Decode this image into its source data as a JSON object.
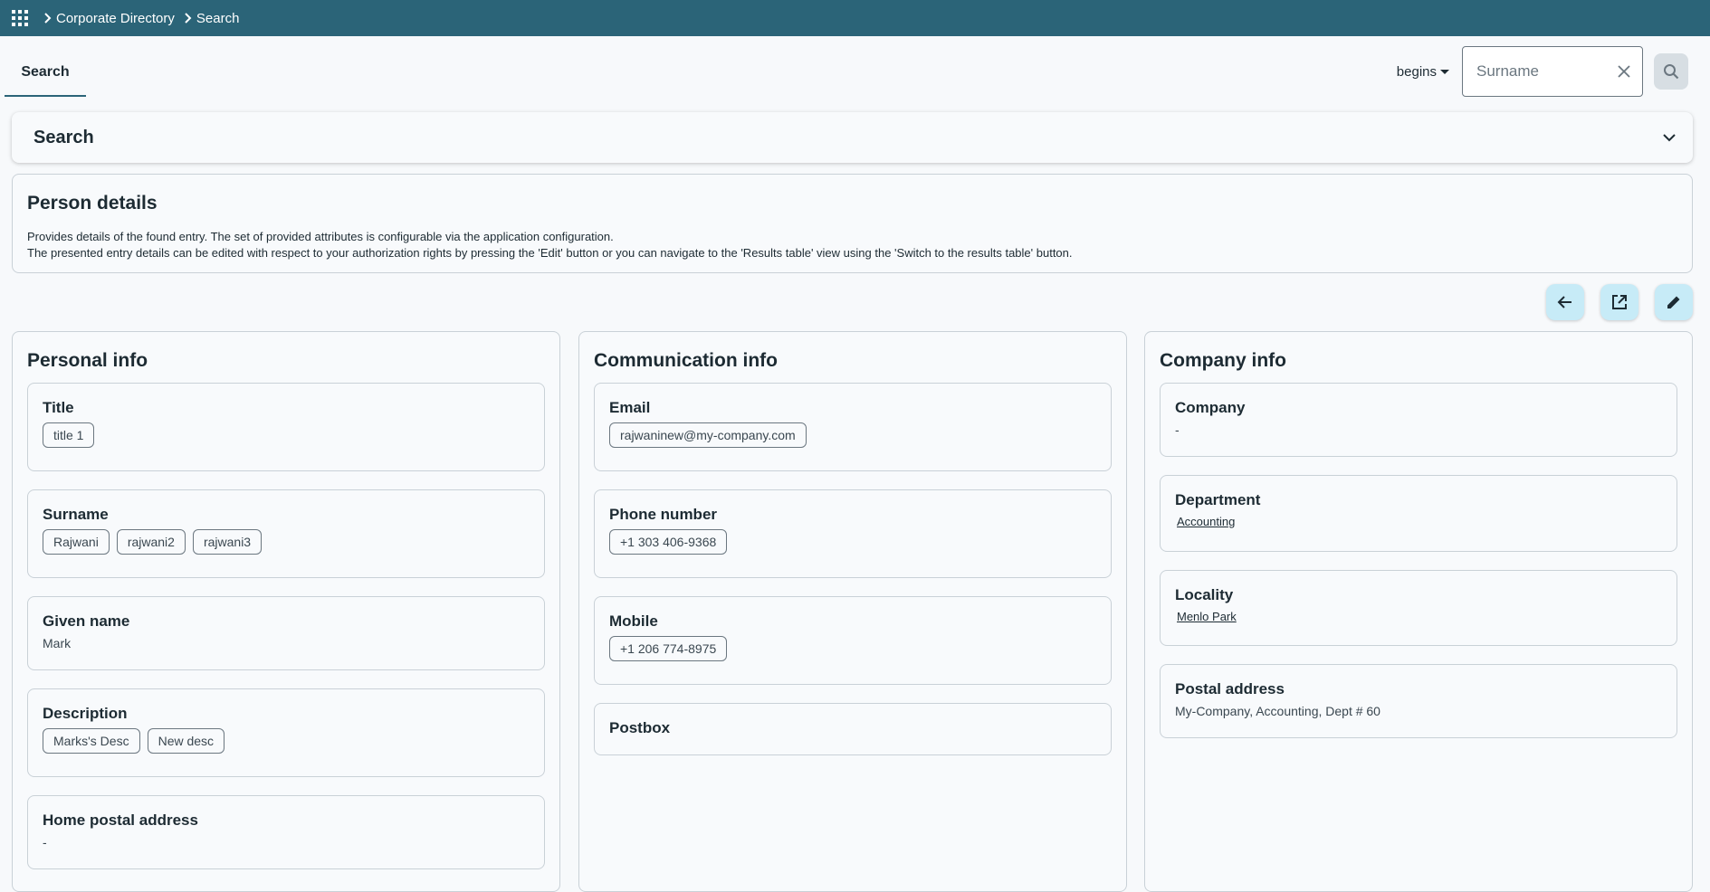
{
  "breadcrumbs": [
    "Corporate Directory",
    "Search"
  ],
  "tab": {
    "label": "Search"
  },
  "search": {
    "match_mode": "begins",
    "placeholder": "Surname",
    "value": ""
  },
  "accordion": {
    "title": "Search"
  },
  "details": {
    "title": "Person details",
    "line1": "Provides details of the found entry. The set of provided attributes is configurable via the application configuration.",
    "line2": "The presented entry details can be edited with respect to your authorization rights by pressing the 'Edit' button or you can navigate to the 'Results table' view using the 'Switch to the results table' button."
  },
  "personal": {
    "title": "Personal info",
    "title_label": "Title",
    "title_values": [
      "title 1"
    ],
    "surname_label": "Surname",
    "surname_values": [
      "Rajwani",
      "rajwani2",
      "rajwani3"
    ],
    "given_label": "Given name",
    "given_value": "Mark",
    "description_label": "Description",
    "description_values": [
      "Marks's Desc",
      "New desc"
    ],
    "home_label": "Home postal address",
    "home_value": "-"
  },
  "communication": {
    "title": "Communication info",
    "email_label": "Email",
    "email_value": "rajwaninew@my-company.com",
    "phone_label": "Phone number",
    "phone_value": "+1 303 406-9368",
    "mobile_label": "Mobile",
    "mobile_value": "+1 206 774-8975",
    "postbox_label": "Postbox"
  },
  "company": {
    "title": "Company info",
    "company_label": "Company",
    "company_value": "-",
    "department_label": "Department",
    "department_value": "Accounting",
    "locality_label": "Locality",
    "locality_value": "Menlo Park",
    "postal_label": "Postal address",
    "postal_value": "My-Company, Accounting, Dept # 60"
  },
  "colors": {
    "header": "#2b6478",
    "action_button": "#c7ebf7"
  },
  "icons": [
    "app-grid-icon",
    "chevron-right-icon",
    "close-icon",
    "search-icon",
    "chevron-down-icon",
    "arrow-left-icon",
    "open-external-icon",
    "edit-pencil-icon"
  ]
}
